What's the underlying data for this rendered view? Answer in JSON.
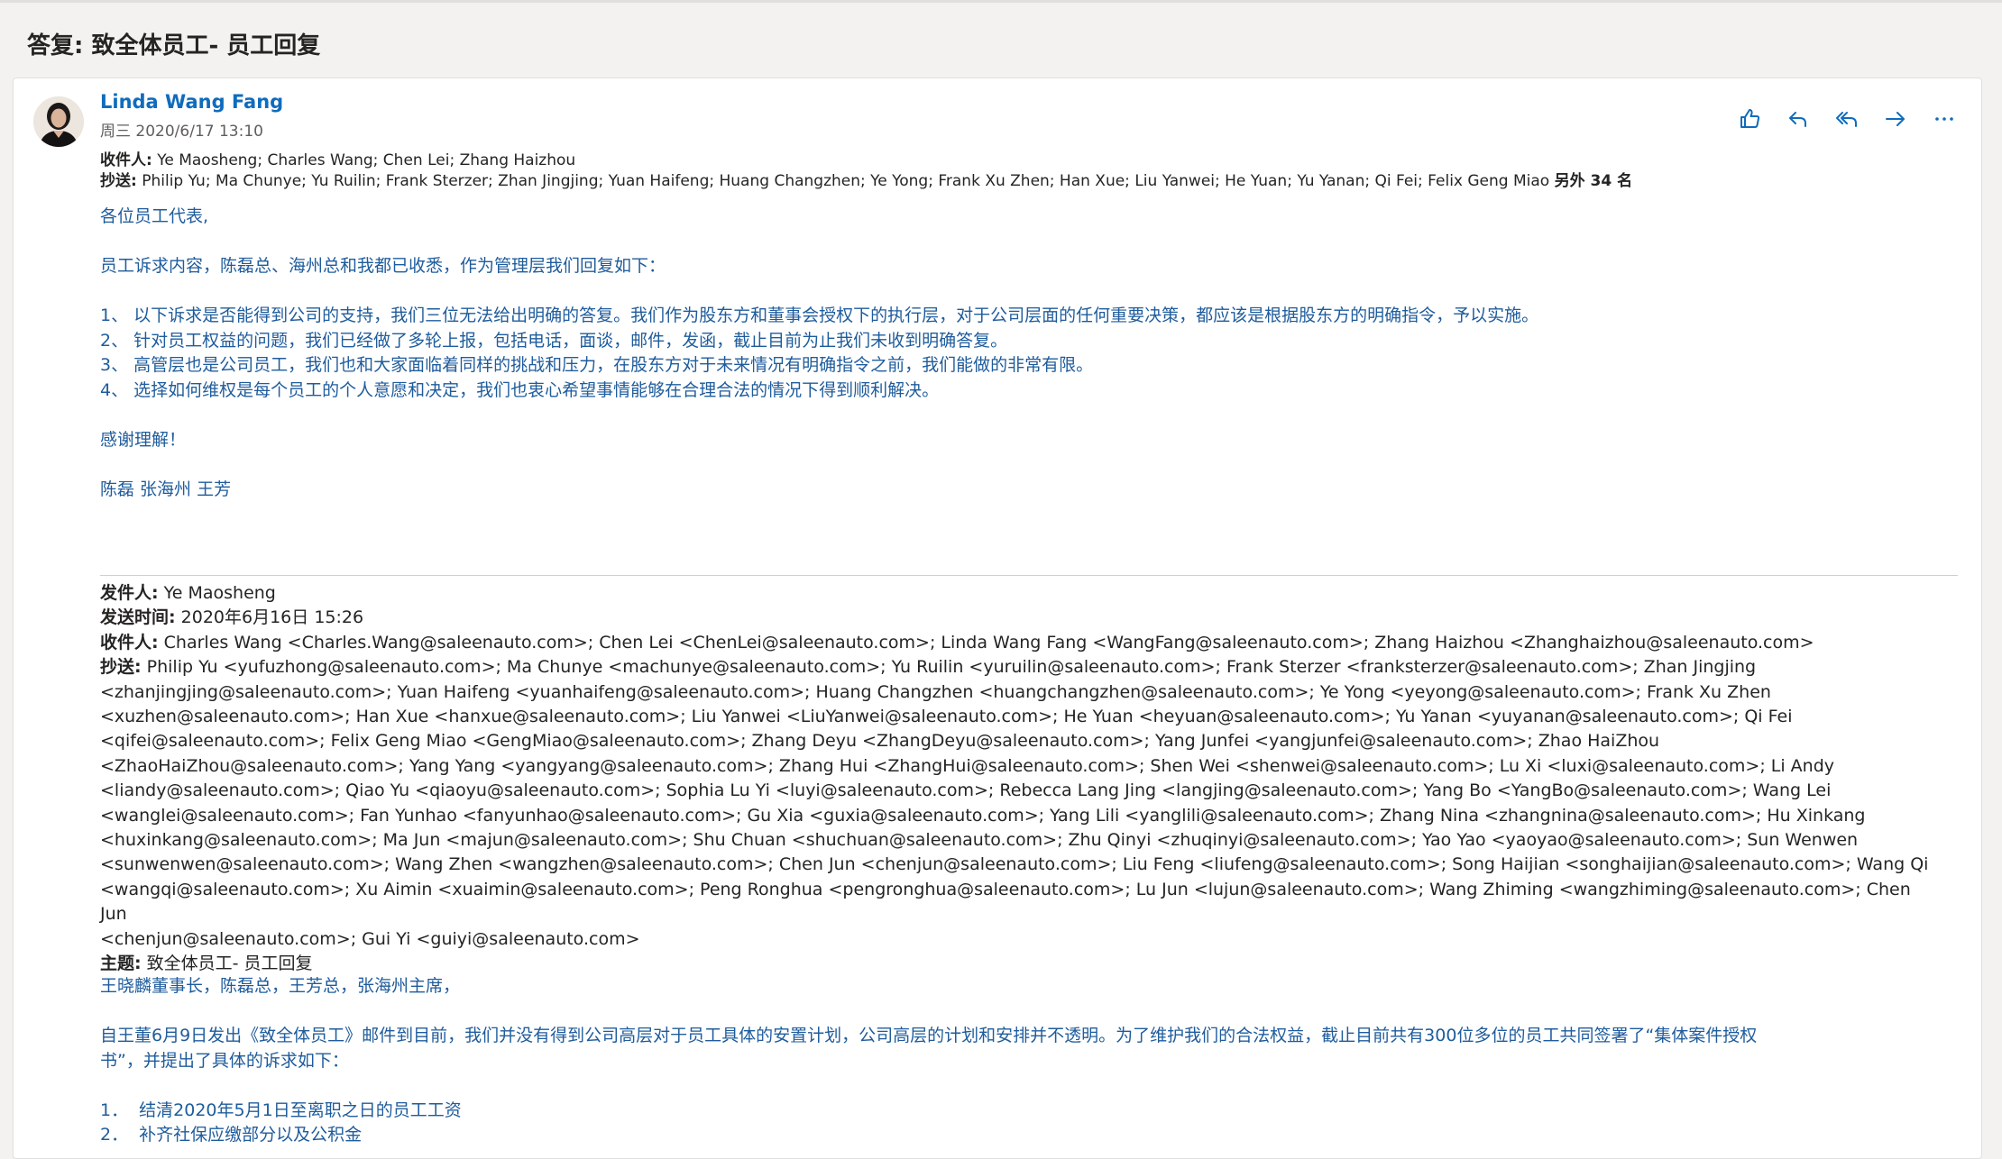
{
  "subject": "答复: 致全体员工- 员工回复",
  "message": {
    "sender": "Linda Wang Fang",
    "date": "周三 2020/6/17 13:10",
    "to_label": "收件人:",
    "to": "Ye Maosheng; Charles Wang; Chen Lei; Zhang Haizhou",
    "cc_label": "抄送:",
    "cc": "Philip Yu; Ma Chunye; Yu Ruilin; Frank Sterzer; Zhan Jingjing; Yuan Haifeng; Huang Changzhen; Ye Yong; Frank Xu Zhen; Han Xue; Liu Yanwei; He Yuan; Yu Yanan; Qi Fei; Felix Geng Miao",
    "cc_more": "另外 34 名",
    "body": [
      "各位员工代表,",
      "",
      "员工诉求内容，陈磊总、海州总和我都已收悉，作为管理层我们回复如下：",
      "",
      "1、 以下诉求是否能得到公司的支持，我们三位无法给出明确的答复。我们作为股东方和董事会授权下的执行层，对于公司层面的任何重要决策，都应该是根据股东方的明确指令，予以实施。",
      "2、 针对员工权益的问题，我们已经做了多轮上报，包括电话，面谈，邮件，发函，截止目前为止我们未收到明确答复。",
      "3、 高管层也是公司员工，我们也和大家面临着同样的挑战和压力，在股东方对于未来情况有明确指令之前，我们能做的非常有限。",
      "4、 选择如何维权是每个员工的个人意愿和决定，我们也衷心希望事情能够在合理合法的情况下得到顺利解决。",
      "",
      "感谢理解！",
      "",
      "陈磊 张海州 王芳"
    ]
  },
  "actions": {
    "like": "like-icon",
    "reply": "reply-icon",
    "reply_all": "reply-all-icon",
    "forward": "forward-icon",
    "more": "more-icon"
  },
  "quoted": {
    "from_label": "发件人:",
    "from": "Ye Maosheng",
    "sent_label": "发送时间:",
    "sent": "2020年6月16日 15:26",
    "to_label": "收件人:",
    "to": "Charles Wang <Charles.Wang@saleenauto.com>; Chen Lei <ChenLei@saleenauto.com>; Linda Wang Fang <WangFang@saleenauto.com>; Zhang Haizhou <Zhanghaizhou@saleenauto.com>",
    "cc_label": "抄送:",
    "cc_lines": [
      "Philip Yu <yufuzhong@saleenauto.com>; Ma Chunye <machunye@saleenauto.com>; Yu Ruilin <yuruilin@saleenauto.com>; Frank Sterzer <franksterzer@saleenauto.com>; Zhan Jingjing",
      "<zhanjingjing@saleenauto.com>; Yuan Haifeng <yuanhaifeng@saleenauto.com>; Huang Changzhen <huangchangzhen@saleenauto.com>; Ye Yong <yeyong@saleenauto.com>; Frank Xu Zhen",
      "<xuzhen@saleenauto.com>; Han Xue <hanxue@saleenauto.com>; Liu Yanwei <LiuYanwei@saleenauto.com>; He Yuan <heyuan@saleenauto.com>; Yu Yanan <yuyanan@saleenauto.com>; Qi Fei",
      "<qifei@saleenauto.com>; Felix Geng Miao <GengMiao@saleenauto.com>; Zhang Deyu <ZhangDeyu@saleenauto.com>; Yang Junfei <yangjunfei@saleenauto.com>; Zhao HaiZhou",
      "<ZhaoHaiZhou@saleenauto.com>; Yang Yang <yangyang@saleenauto.com>; Zhang Hui <ZhangHui@saleenauto.com>; Shen Wei <shenwei@saleenauto.com>; Lu Xi <luxi@saleenauto.com>; Li Andy",
      "<liandy@saleenauto.com>; Qiao Yu <qiaoyu@saleenauto.com>; Sophia Lu Yi <luyi@saleenauto.com>; Rebecca Lang Jing <langjing@saleenauto.com>; Yang Bo <YangBo@saleenauto.com>; Wang Lei",
      "<wanglei@saleenauto.com>; Fan Yunhao <fanyunhao@saleenauto.com>; Gu Xia <guxia@saleenauto.com>; Yang Lili <yanglili@saleenauto.com>; Zhang Nina <zhangnina@saleenauto.com>; Hu Xinkang",
      "<huxinkang@saleenauto.com>; Ma Jun <majun@saleenauto.com>; Shu Chuan <shuchuan@saleenauto.com>; Zhu Qinyi <zhuqinyi@saleenauto.com>; Yao Yao <yaoyao@saleenauto.com>; Sun Wenwen",
      "<sunwenwen@saleenauto.com>; Wang Zhen <wangzhen@saleenauto.com>; Chen Jun <chenjun@saleenauto.com>; Liu Feng <liufeng@saleenauto.com>; Song Haijian <songhaijian@saleenauto.com>; Wang Qi",
      "<wangqi@saleenauto.com>; Xu Aimin <xuaimin@saleenauto.com>; Peng Ronghua <pengronghua@saleenauto.com>; Lu Jun <lujun@saleenauto.com>; Wang Zhiming <wangzhiming@saleenauto.com>; Chen Jun",
      "<chenjun@saleenauto.com>; Gui Yi <guiyi@saleenauto.com>"
    ],
    "subject_label": "主题:",
    "subject": "致全体员工- 员工回复",
    "body": [
      "王晓麟董事长，陈磊总，王芳总，张海州主席，",
      "",
      "自王董6月9日发出《致全体员工》邮件到目前，我们并没有得到公司高层对于员工具体的安置计划，公司高层的计划和安排并不透明。为了维护我们的合法权益，截止目前共有300位多位的员工共同签署了“集体案件授权",
      "书”，并提出了具体的诉求如下：",
      "",
      "1．  结清2020年5月1日至离职之日的员工工资",
      "2．  补齐社保应缴部分以及公积金"
    ]
  }
}
